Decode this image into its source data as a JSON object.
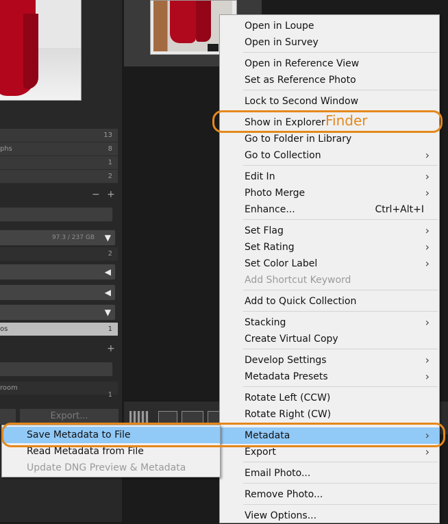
{
  "left_panel": {
    "collection_rows": [
      {
        "label": "",
        "count": "13"
      },
      {
        "label": "phs",
        "count": "8"
      },
      {
        "label": "",
        "count": "1"
      },
      {
        "label": "",
        "count": "2"
      }
    ],
    "folders_header": {
      "minus": "−",
      "plus": "+"
    },
    "volume_size": "97.3 / 237 GB",
    "folder_rows": [
      {
        "count": "2"
      }
    ],
    "selected_row": {
      "label": "os",
      "count": "1"
    },
    "collections_header": {
      "plus": "+"
    },
    "sub_row_label": "room",
    "sub_row_count": "1",
    "export_button": "Export..."
  },
  "left_menu": {
    "items": [
      {
        "label": "Save Metadata to File",
        "state": "highlighted"
      },
      {
        "label": "Read Metadata from File",
        "state": "normal"
      },
      {
        "label": "Update DNG Preview & Metadata",
        "state": "disabled"
      }
    ]
  },
  "context_menu": {
    "items": [
      {
        "label": "Open in Loupe"
      },
      {
        "label": "Open in Survey"
      },
      {
        "label": "Open in Reference View"
      },
      {
        "label": "Set as Reference Photo"
      },
      {
        "label": "Lock to Second Window"
      },
      {
        "label": "Show in Explorer"
      },
      {
        "label": "Go to Folder in Library"
      },
      {
        "label": "Go to Collection",
        "submenu": true
      },
      {
        "label": "Edit In",
        "submenu": true
      },
      {
        "label": "Photo Merge",
        "submenu": true
      },
      {
        "label": "Enhance...",
        "shortcut": "Ctrl+Alt+I"
      },
      {
        "label": "Set Flag",
        "submenu": true
      },
      {
        "label": "Set Rating",
        "submenu": true
      },
      {
        "label": "Set Color Label",
        "submenu": true
      },
      {
        "label": "Add Shortcut Keyword",
        "disabled": true
      },
      {
        "label": "Add to Quick Collection"
      },
      {
        "label": "Stacking",
        "submenu": true
      },
      {
        "label": "Create Virtual Copy"
      },
      {
        "label": "Develop Settings",
        "submenu": true
      },
      {
        "label": "Metadata Presets",
        "submenu": true
      },
      {
        "label": "Rotate Left (CCW)"
      },
      {
        "label": "Rotate Right (CW)"
      },
      {
        "label": "Metadata",
        "submenu": true,
        "highlighted": true
      },
      {
        "label": "Export",
        "submenu": true
      },
      {
        "label": "Email Photo..."
      },
      {
        "label": "Remove Photo..."
      },
      {
        "label": "View Options..."
      }
    ],
    "submenu_arrow": "›"
  },
  "annotation": {
    "finder_label": "Finder",
    "ring_color": "#e4881c"
  },
  "colors": {
    "menu_bg": "#f0f0f0",
    "highlight": "#91c9f7",
    "disabled_text": "#9a9a9a",
    "panel_bg": "#282828"
  }
}
